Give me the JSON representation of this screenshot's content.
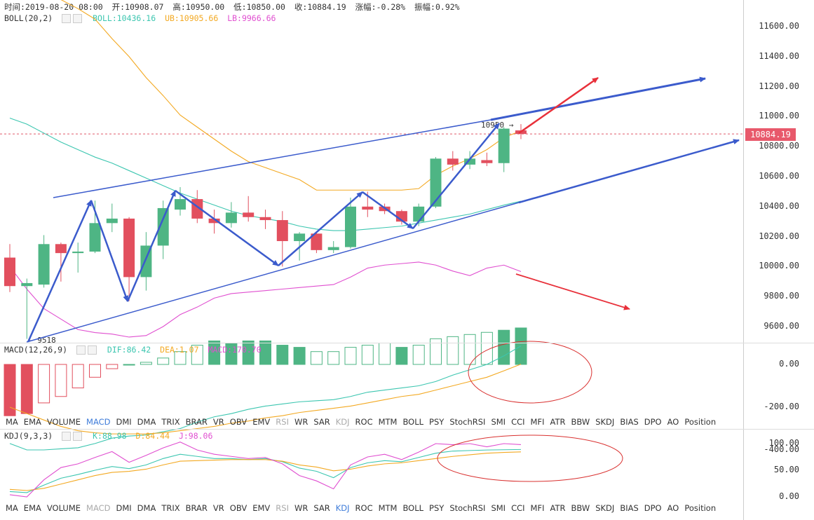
{
  "header": {
    "time_label": "时间:2019-08-20 08:00",
    "open_label": "开:10908.07",
    "high_label": "高:10950.00",
    "low_label": "低:10850.00",
    "close_label": "收:10884.19",
    "change_label": "涨幅:-0.28%",
    "amplitude_label": "振幅:0.92%"
  },
  "boll_legend": {
    "name": "BOLL(20,2)",
    "boll": "BOLL:10436.16",
    "ub": "UB:10905.66",
    "lb": "LB:9966.66"
  },
  "macd_legend": {
    "name": "MACD(12,26,9)",
    "dif": "DIF:86.42",
    "dea": "DEA:1.07",
    "macd": "MACD:170.70"
  },
  "kdj_legend": {
    "name": "KDJ(9,3,3)",
    "k": "K:88.98",
    "d": "D:84.44",
    "j": "J:98.06"
  },
  "price_axis": [
    "11600.00",
    "11400.00",
    "11200.00",
    "11000.00",
    "10800.00",
    "10600.00",
    "10400.00",
    "10200.00",
    "10000.00",
    "9800.00",
    "9600.00"
  ],
  "current_price": "10884.19",
  "macd_axis": [
    "0.00",
    "-200.00",
    "-400.00"
  ],
  "kdj_axis": [
    "100.00",
    "50.00",
    "0.00"
  ],
  "annotations": {
    "high_marker": "10950 →",
    "low_marker": "← 9518"
  },
  "indicator_tabs_1": [
    {
      "label": "MA",
      "state": "normal"
    },
    {
      "label": "EMA",
      "state": "normal"
    },
    {
      "label": "VOLUME",
      "state": "normal"
    },
    {
      "label": "MACD",
      "state": "active"
    },
    {
      "label": "DMI",
      "state": "normal"
    },
    {
      "label": "DMA",
      "state": "normal"
    },
    {
      "label": "TRIX",
      "state": "normal"
    },
    {
      "label": "BRAR",
      "state": "normal"
    },
    {
      "label": "VR",
      "state": "normal"
    },
    {
      "label": "OBV",
      "state": "normal"
    },
    {
      "label": "EMV",
      "state": "normal"
    },
    {
      "label": "RSI",
      "state": "dim"
    },
    {
      "label": "WR",
      "state": "normal"
    },
    {
      "label": "SAR",
      "state": "normal"
    },
    {
      "label": "KDJ",
      "state": "dim"
    },
    {
      "label": "ROC",
      "state": "normal"
    },
    {
      "label": "MTM",
      "state": "normal"
    },
    {
      "label": "BOLL",
      "state": "normal"
    },
    {
      "label": "PSY",
      "state": "normal"
    },
    {
      "label": "StochRSI",
      "state": "normal"
    },
    {
      "label": "SMI",
      "state": "normal"
    },
    {
      "label": "CCI",
      "state": "normal"
    },
    {
      "label": "MFI",
      "state": "normal"
    },
    {
      "label": "ATR",
      "state": "normal"
    },
    {
      "label": "BBW",
      "state": "normal"
    },
    {
      "label": "SKDJ",
      "state": "normal"
    },
    {
      "label": "BIAS",
      "state": "normal"
    },
    {
      "label": "DPO",
      "state": "normal"
    },
    {
      "label": "AO",
      "state": "normal"
    },
    {
      "label": "Position",
      "state": "normal"
    }
  ],
  "indicator_tabs_2": [
    {
      "label": "MA",
      "state": "normal"
    },
    {
      "label": "EMA",
      "state": "normal"
    },
    {
      "label": "VOLUME",
      "state": "normal"
    },
    {
      "label": "MACD",
      "state": "dim"
    },
    {
      "label": "DMI",
      "state": "normal"
    },
    {
      "label": "DMA",
      "state": "normal"
    },
    {
      "label": "TRIX",
      "state": "normal"
    },
    {
      "label": "BRAR",
      "state": "normal"
    },
    {
      "label": "VR",
      "state": "normal"
    },
    {
      "label": "OBV",
      "state": "normal"
    },
    {
      "label": "EMV",
      "state": "normal"
    },
    {
      "label": "RSI",
      "state": "dim"
    },
    {
      "label": "WR",
      "state": "normal"
    },
    {
      "label": "SAR",
      "state": "normal"
    },
    {
      "label": "KDJ",
      "state": "active"
    },
    {
      "label": "ROC",
      "state": "normal"
    },
    {
      "label": "MTM",
      "state": "normal"
    },
    {
      "label": "BOLL",
      "state": "normal"
    },
    {
      "label": "PSY",
      "state": "normal"
    },
    {
      "label": "StochRSI",
      "state": "normal"
    },
    {
      "label": "SMI",
      "state": "normal"
    },
    {
      "label": "CCI",
      "state": "normal"
    },
    {
      "label": "MFI",
      "state": "normal"
    },
    {
      "label": "ATR",
      "state": "normal"
    },
    {
      "label": "BBW",
      "state": "normal"
    },
    {
      "label": "SKDJ",
      "state": "normal"
    },
    {
      "label": "BIAS",
      "state": "normal"
    },
    {
      "label": "DPO",
      "state": "normal"
    },
    {
      "label": "AO",
      "state": "normal"
    },
    {
      "label": "Position",
      "state": "normal"
    }
  ],
  "colors": {
    "up": "#4eb584",
    "down": "#e24f5e",
    "boll_mid": "#3cc6b0",
    "boll_ub": "#f3a922",
    "boll_lb": "#e04fd0",
    "dif": "#3cc6b0",
    "dea": "#f3a922",
    "j_line": "#e04fd0",
    "trend": "#3b5bcc",
    "arrow_red": "#e8303a",
    "ellipse": "#d9302f",
    "ref_line": "#e05a6a"
  },
  "chart_data": {
    "type": "candlestick",
    "price_ylim": [
      9500,
      11750
    ],
    "candles": [
      {
        "o": 10060,
        "h": 10150,
        "l": 9830,
        "c": 9870
      },
      {
        "o": 9870,
        "h": 9920,
        "l": 9518,
        "c": 9890
      },
      {
        "o": 9880,
        "h": 10210,
        "l": 9860,
        "c": 10150
      },
      {
        "o": 10150,
        "h": 10160,
        "l": 9900,
        "c": 10090
      },
      {
        "o": 10090,
        "h": 10160,
        "l": 9960,
        "c": 10100
      },
      {
        "o": 10100,
        "h": 10440,
        "l": 10090,
        "c": 10290
      },
      {
        "o": 10290,
        "h": 10420,
        "l": 10230,
        "c": 10320
      },
      {
        "o": 10320,
        "h": 10330,
        "l": 9770,
        "c": 9930
      },
      {
        "o": 9930,
        "h": 10230,
        "l": 9840,
        "c": 10140
      },
      {
        "o": 10140,
        "h": 10440,
        "l": 10050,
        "c": 10390
      },
      {
        "o": 10380,
        "h": 10530,
        "l": 10340,
        "c": 10450
      },
      {
        "o": 10450,
        "h": 10510,
        "l": 10290,
        "c": 10320
      },
      {
        "o": 10320,
        "h": 10380,
        "l": 10220,
        "c": 10290
      },
      {
        "o": 10290,
        "h": 10430,
        "l": 10260,
        "c": 10360
      },
      {
        "o": 10360,
        "h": 10470,
        "l": 10300,
        "c": 10330
      },
      {
        "o": 10330,
        "h": 10380,
        "l": 10250,
        "c": 10310
      },
      {
        "o": 10310,
        "h": 10370,
        "l": 10000,
        "c": 10170
      },
      {
        "o": 10170,
        "h": 10230,
        "l": 10040,
        "c": 10220
      },
      {
        "o": 10220,
        "h": 10230,
        "l": 10090,
        "c": 10110
      },
      {
        "o": 10110,
        "h": 10170,
        "l": 10090,
        "c": 10130
      },
      {
        "o": 10130,
        "h": 10460,
        "l": 10120,
        "c": 10400
      },
      {
        "o": 10400,
        "h": 10500,
        "l": 10330,
        "c": 10380
      },
      {
        "o": 10400,
        "h": 10420,
        "l": 10350,
        "c": 10370
      },
      {
        "o": 10370,
        "h": 10380,
        "l": 10280,
        "c": 10300
      },
      {
        "o": 10300,
        "h": 10420,
        "l": 10270,
        "c": 10400
      },
      {
        "o": 10400,
        "h": 10730,
        "l": 10390,
        "c": 10720
      },
      {
        "o": 10720,
        "h": 10770,
        "l": 10640,
        "c": 10680
      },
      {
        "o": 10680,
        "h": 10770,
        "l": 10650,
        "c": 10720
      },
      {
        "o": 10710,
        "h": 10760,
        "l": 10670,
        "c": 10690
      },
      {
        "o": 10690,
        "h": 10930,
        "l": 10630,
        "c": 10920
      },
      {
        "o": 10908.07,
        "h": 10950,
        "l": 10850,
        "c": 10884.19
      }
    ],
    "boll_mid": [
      10990,
      10950,
      10890,
      10830,
      10780,
      10730,
      10690,
      10640,
      10590,
      10540,
      10490,
      10450,
      10410,
      10370,
      10340,
      10320,
      10300,
      10270,
      10250,
      10240,
      10240,
      10250,
      10260,
      10270,
      10290,
      10310,
      10330,
      10350,
      10380,
      10410,
      10436.16
    ],
    "boll_ub": [
      11950,
      11900,
      11840,
      11780,
      11720,
      11650,
      11520,
      11400,
      11260,
      11140,
      11010,
      10930,
      10850,
      10770,
      10700,
      10660,
      10620,
      10580,
      10510,
      10510,
      10510,
      10510,
      10510,
      10510,
      10520,
      10610,
      10670,
      10720,
      10780,
      10860,
      10905.66
    ],
    "boll_lb": [
      10000,
      9850,
      9720,
      9650,
      9580,
      9560,
      9550,
      9530,
      9540,
      9600,
      9680,
      9730,
      9790,
      9820,
      9830,
      9840,
      9850,
      9860,
      9870,
      9880,
      9930,
      9990,
      10010,
      10020,
      10030,
      10010,
      9970,
      9940,
      9990,
      10010,
      9966.66
    ],
    "macd_ylim": [
      -470,
      100
    ],
    "macd_hist": [
      -240,
      -230,
      -180,
      -150,
      -110,
      -60,
      -20,
      0,
      10,
      30,
      60,
      90,
      110,
      100,
      110,
      110,
      90,
      80,
      60,
      60,
      80,
      90,
      100,
      80,
      90,
      120,
      130,
      140,
      150,
      160,
      170.7
    ],
    "dif": [
      -370,
      -400,
      -400,
      -395,
      -390,
      -370,
      -345,
      -335,
      -330,
      -315,
      -300,
      -270,
      -245,
      -230,
      -210,
      -195,
      -185,
      -175,
      -170,
      -165,
      -150,
      -130,
      -120,
      -110,
      -100,
      -80,
      -50,
      -25,
      0,
      40,
      86.42
    ],
    "dea": [
      -200,
      -230,
      -260,
      -290,
      -310,
      -320,
      -325,
      -325,
      -325,
      -320,
      -310,
      -300,
      -290,
      -275,
      -265,
      -250,
      -240,
      -225,
      -215,
      -205,
      -195,
      -180,
      -165,
      -150,
      -140,
      -120,
      -100,
      -80,
      -60,
      -30,
      1.07
    ],
    "kdj_ylim": [
      -5,
      115
    ],
    "k": [
      10,
      8,
      22,
      35,
      42,
      50,
      57,
      53,
      60,
      72,
      80,
      76,
      72,
      72,
      70,
      72,
      66,
      54,
      48,
      36,
      55,
      64,
      68,
      66,
      74,
      82,
      86,
      87,
      88,
      88.5,
      88.98
    ],
    "d": [
      14,
      12,
      16,
      24,
      32,
      40,
      46,
      48,
      52,
      60,
      67,
      68,
      69,
      70,
      70,
      70,
      67,
      60,
      56,
      49,
      52,
      58,
      62,
      64,
      68,
      72,
      76,
      79,
      82,
      83.5,
      84.44
    ],
    "j": [
      4,
      0,
      32,
      55,
      62,
      74,
      85,
      65,
      78,
      92,
      103,
      88,
      80,
      76,
      72,
      74,
      62,
      40,
      30,
      15,
      60,
      75,
      80,
      70,
      84,
      100,
      98,
      100,
      94,
      100,
      98.06
    ]
  }
}
